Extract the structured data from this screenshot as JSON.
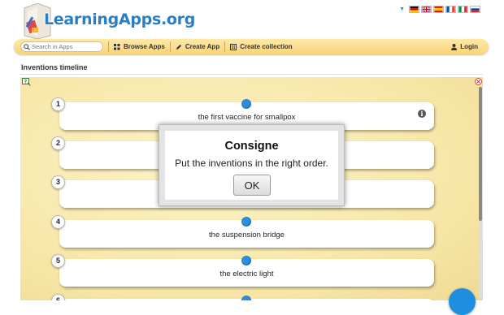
{
  "header": {
    "logo_text": "LearningApps.org",
    "flags": [
      "de",
      "gb",
      "es",
      "fr",
      "it",
      "ru"
    ]
  },
  "nav": {
    "search_placeholder": "Search in Apps",
    "browse": "Browse Apps",
    "create_app": "Create App",
    "create_collection": "Create collection",
    "login": "Login"
  },
  "app": {
    "title": "Inventions timeline",
    "items": [
      {
        "number": "1",
        "text": "the first vaccine for smallpox"
      },
      {
        "number": "2",
        "text": ""
      },
      {
        "number": "3",
        "text": ""
      },
      {
        "number": "4",
        "text": "the suspension bridge"
      },
      {
        "number": "5",
        "text": "the electric light"
      },
      {
        "number": "6",
        "text": ""
      }
    ]
  },
  "modal": {
    "title": "Consigne",
    "message": "Put the inventions in the right order.",
    "ok_label": "OK"
  },
  "colors": {
    "accent": "#2b8fdb",
    "navbar": "#f8d47c",
    "app_background": "#f6e5a4"
  }
}
